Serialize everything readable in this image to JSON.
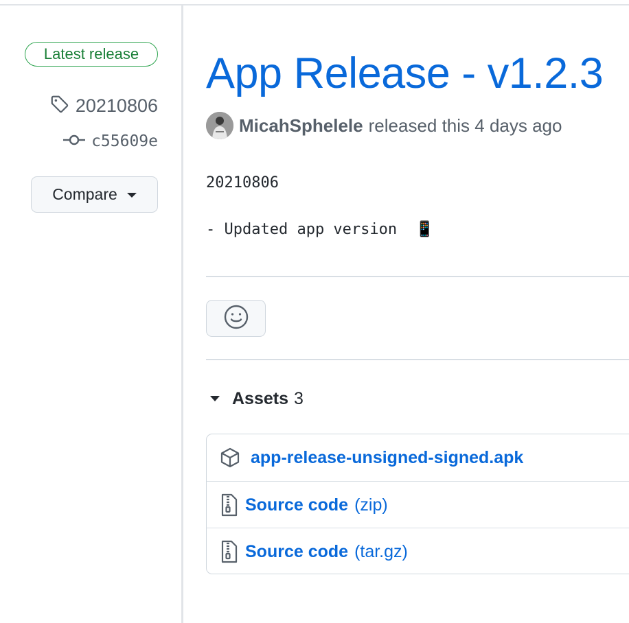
{
  "sidebar": {
    "badge": "Latest release",
    "tag": "20210806",
    "commit": "c55609e",
    "compare_label": "Compare"
  },
  "release": {
    "title": "App Release - v1.2.3",
    "author": "MicahSphelele",
    "meta": "released this 4 days ago",
    "body_line1": "20210806",
    "body_line2": "- Updated app version  📱"
  },
  "assets": {
    "label": "Assets",
    "count": "3",
    "items": [
      {
        "name": "app-release-unsigned-signed.apk",
        "ext": "",
        "icon": "package-icon"
      },
      {
        "name": "Source code",
        "ext": "(zip)",
        "icon": "file-zip-icon"
      },
      {
        "name": "Source code",
        "ext": "(tar.gz)",
        "icon": "file-zip-icon"
      }
    ]
  },
  "colors": {
    "link": "#0969da",
    "badge_green": "#1a7f37",
    "muted": "#57606a",
    "border": "#d0d7de"
  }
}
